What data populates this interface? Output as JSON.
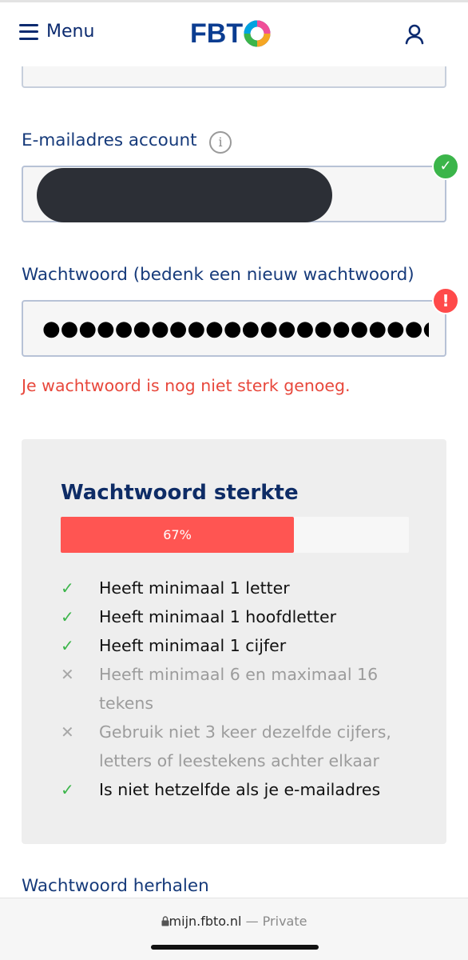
{
  "header": {
    "menu_label": "Menu",
    "logo_text_fbt": "FBT",
    "logo_text_o": "O"
  },
  "email": {
    "label": "E-mailadres account",
    "status": "valid"
  },
  "password": {
    "label": "Wachtwoord (bedenk een nieuw wachtwoord)",
    "masked_value": "●●●●●●●●●●●●●●●●●●●●●●●●●●●●",
    "status": "error",
    "error_text": "Je wachtwoord is nog niet sterk genoeg."
  },
  "strength": {
    "title": "Wachtwoord sterkte",
    "percent": 67,
    "percent_label": "67%",
    "bar_color": "#ff5552",
    "requirements": [
      {
        "text": "Heeft minimaal 1 letter",
        "met": true
      },
      {
        "text": "Heeft minimaal 1 hoofdletter",
        "met": true
      },
      {
        "text": "Heeft minimaal 1 cijfer",
        "met": true
      },
      {
        "text": "Heeft minimaal 6 en maximaal 16 tekens",
        "met": false
      },
      {
        "text": "Gebruik niet 3 keer dezelfde cijfers, letters of leestekens achter elkaar",
        "met": false
      },
      {
        "text": "Is niet hetzelfde als je e-mailadres",
        "met": true
      }
    ]
  },
  "repeat_password": {
    "label": "Wachtwoord herhalen"
  },
  "browser": {
    "domain": "mijn.fbto.nl",
    "separator": "—",
    "mode": "Private"
  },
  "colors": {
    "brand_blue": "#0b3d91",
    "success": "#3bb54a",
    "error": "#e8483c"
  }
}
